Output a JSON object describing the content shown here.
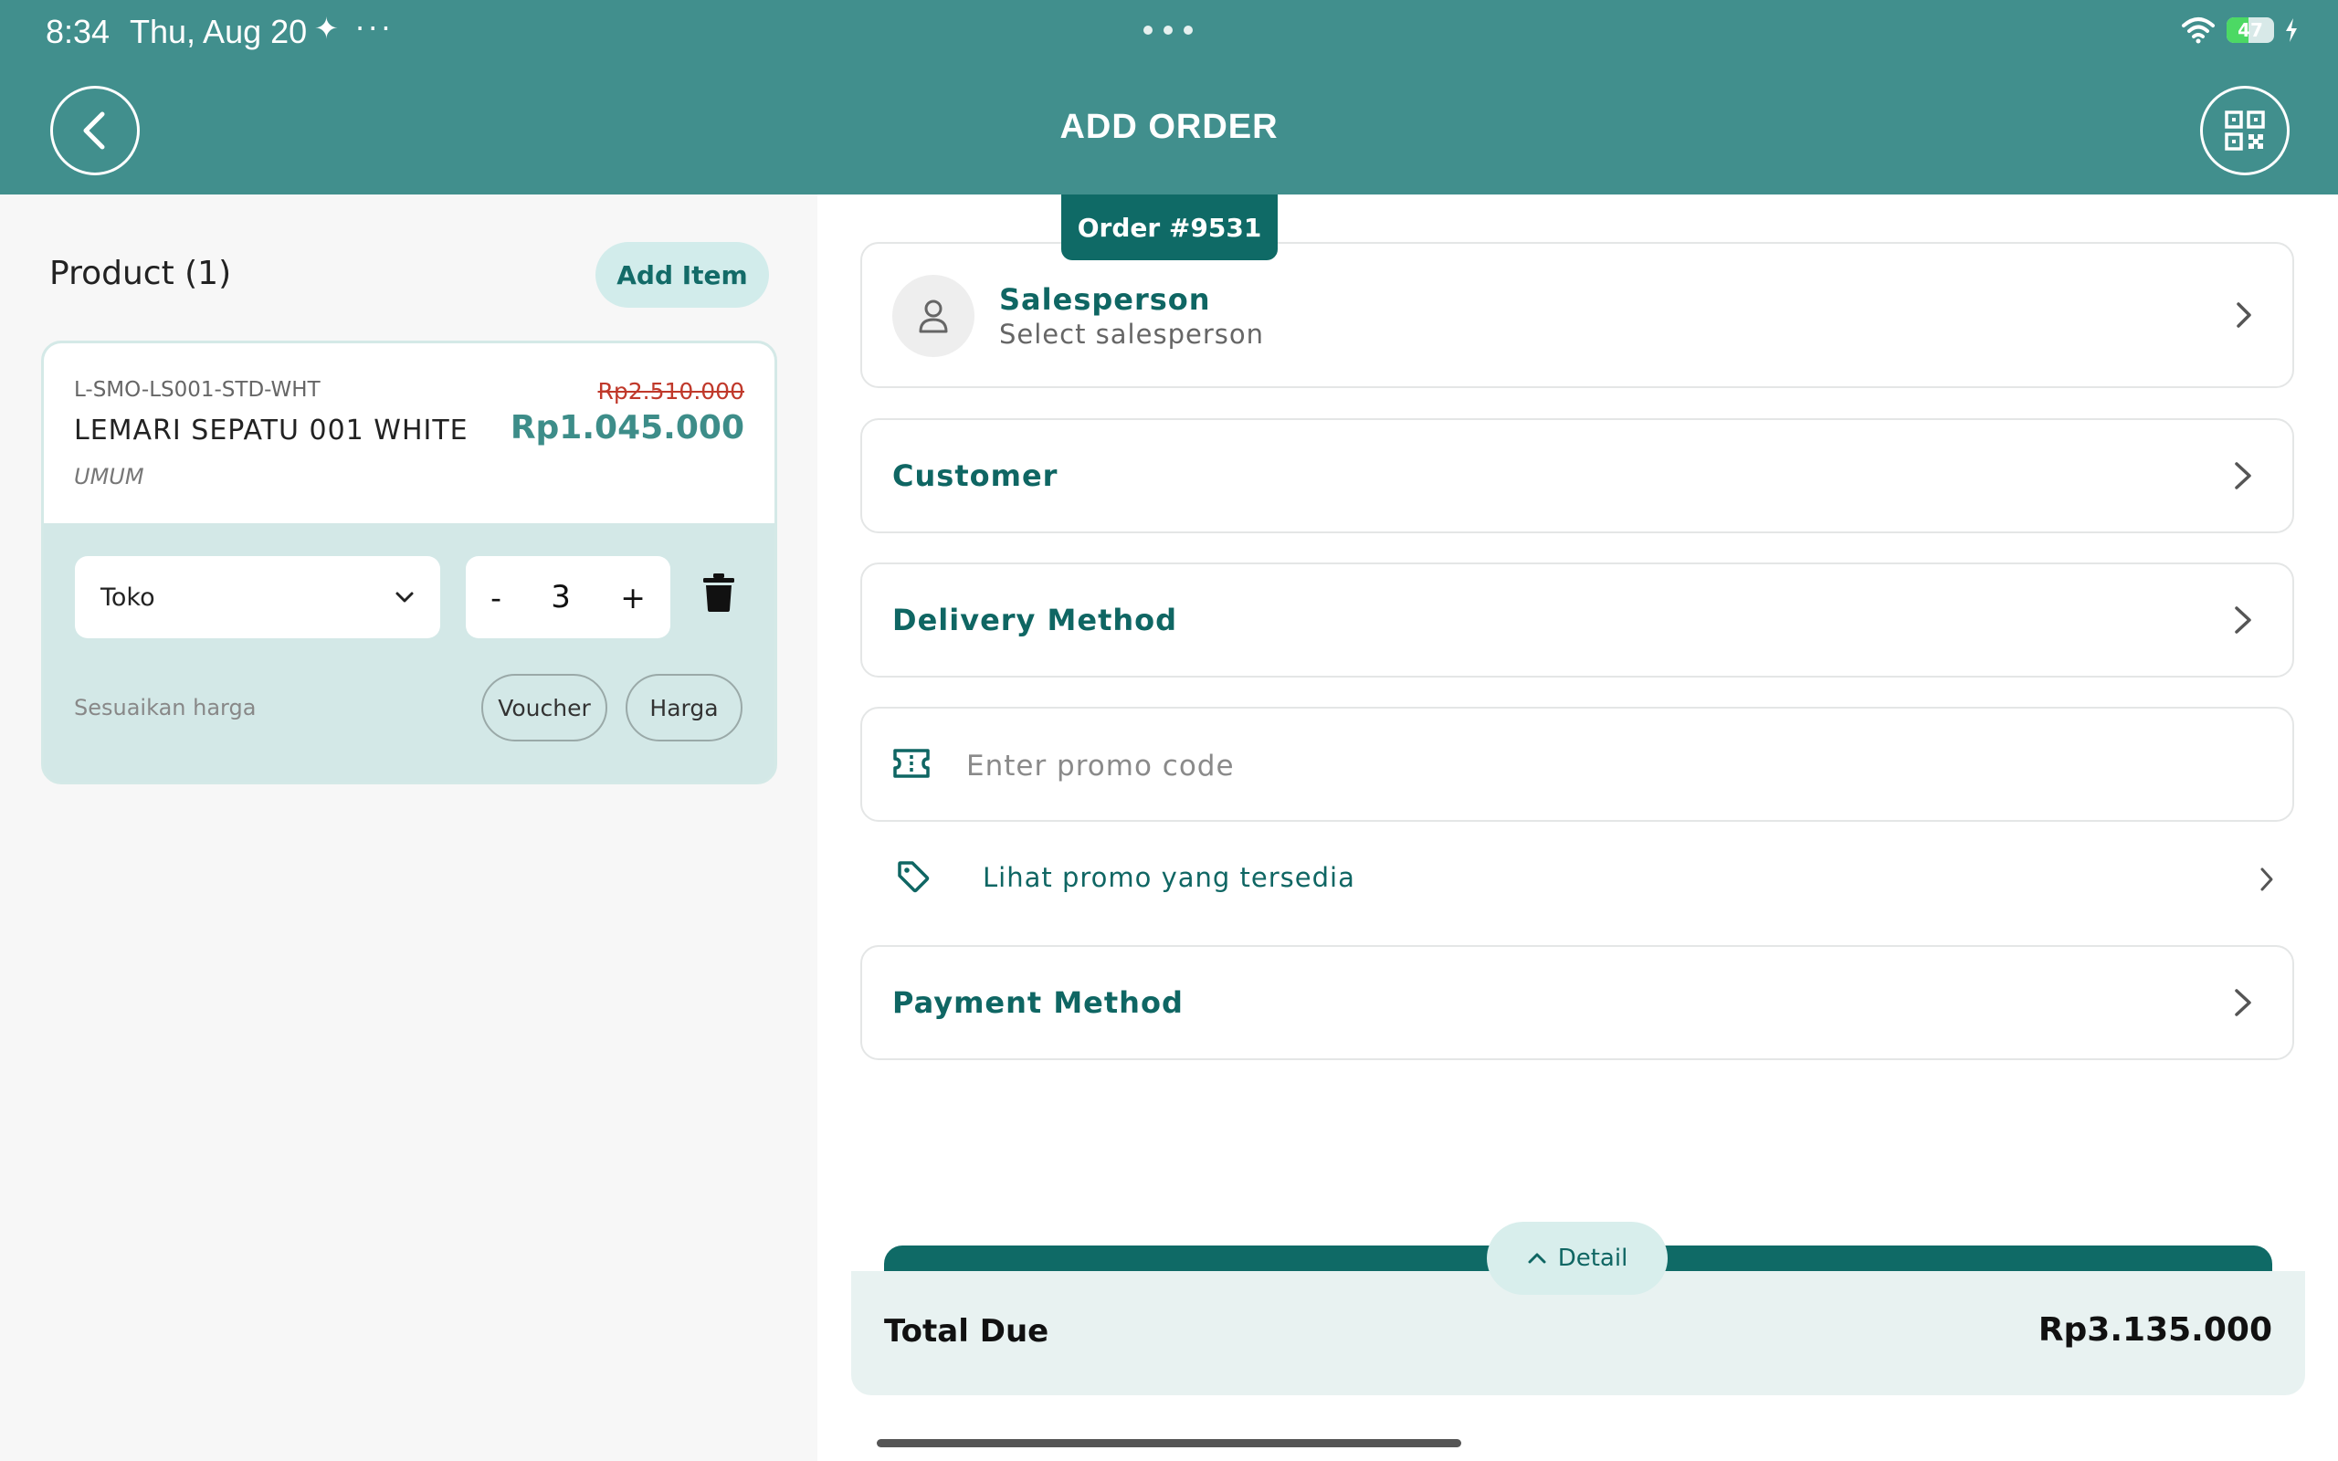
{
  "status_bar": {
    "time": "8:34",
    "date": "Thu, Aug 20",
    "extra": "✦ ···",
    "battery": "47",
    "battery_level": 0.47
  },
  "header": {
    "title": "ADD ORDER",
    "back_icon": "chevron-left-icon",
    "scan_icon": "qr-scan-icon"
  },
  "products": {
    "title": "Product (1)",
    "add_item_label": "Add Item",
    "items": [
      {
        "sku": "L-SMO-LS001-STD-WHT",
        "name": "LEMARI SEPATU 001 WHITE",
        "category": "UMUM",
        "original_price": "Rp2.510.000",
        "price": "Rp1.045.000",
        "location": "Toko",
        "qty_minus": "-",
        "quantity": "3",
        "qty_plus": "+",
        "adjust_label": "Sesuaikan harga",
        "voucher_label": "Voucher",
        "price_label": "Harga"
      }
    ]
  },
  "order": {
    "tab_label": "Order #9531",
    "salesperson": {
      "title": "Salesperson",
      "placeholder": "Select salesperson"
    },
    "customer_label": "Customer",
    "delivery_label": "Delivery Method",
    "promo": {
      "placeholder": "Enter promo code",
      "link_text": "Lihat promo yang tersedia"
    },
    "payment_label": "Payment Method"
  },
  "summary": {
    "detail_label": "Detail",
    "total_label": "Total Due",
    "total_value": "Rp3.135.000"
  },
  "colors": {
    "primary": "#418f8d",
    "dark_teal": "#0f6a66",
    "accent_text": "#0f6663",
    "strike_price": "#c0392b"
  }
}
